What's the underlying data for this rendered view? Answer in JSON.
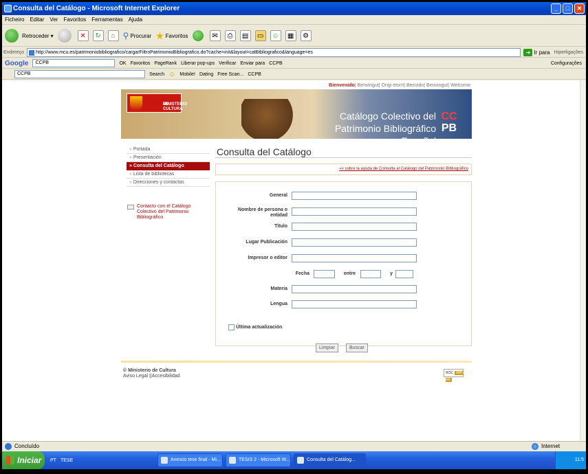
{
  "window": {
    "title": "Consulta del Catálogo - Microsoft Internet Explorer"
  },
  "menubar": [
    "Ficheiro",
    "Editar",
    "Ver",
    "Favoritos",
    "Ferramentas",
    "Ajuda"
  ],
  "toolbar": {
    "back": "Retroceder",
    "search": "Procurar",
    "favorites": "Favoritos"
  },
  "addressbar": {
    "label": "Endereço",
    "url": "http://www.mcu.es/patrimoniobibliografico/cargarFiltroPatrimonioBibliografico.do?cache=init&layout=catBibliografico&language=es",
    "go": "Ir para",
    "links": "Hiperligações"
  },
  "googlebar": {
    "logo_g": "Google",
    "query": "CCPB",
    "ok": "OK",
    "favoritos": "Favoritos",
    "pagerank": "PageRank",
    "popups": "Liberar pop-ups",
    "verificar": "Verificar",
    "enviar": "Enviar para",
    "ccpb": "CCPB",
    "config": "Configurações"
  },
  "ccpbbar": {
    "query": "CCPB",
    "search": "Search",
    "mobile": "Mobile!",
    "dating": "Dating",
    "freescan": "Free Scan...",
    "ccpb": "CCPB"
  },
  "page": {
    "welcome_prefix": "Bienvenido",
    "welcome_rest": "| Benvingut| Ongi etorri| Benvido| Benvingut| Welcome",
    "header": {
      "ministerio_line1": "MINISTERIO",
      "ministerio_line2": "DE CULTURA",
      "title_line1": "Catálogo Colectivo del",
      "title_line2": "Patrimonio Bibliográfico Español",
      "ccpb_top": "CC",
      "ccpb_bottom": "PB"
    },
    "nav": [
      "Portada",
      "Presentación",
      "Consulta del Catálogo",
      "Lista de bibliotecas",
      "Direcciones y contactos"
    ],
    "contact": "Contacto con el Catálogo Colectivo del Patrimonio Bibliográfico",
    "title": "Consulta del Catálogo",
    "help_link": "sobre la ayuda de Consulta al Catálogo del Patrimonio Bibliográfico",
    "form": {
      "general": "General",
      "persona": "Nombre de persona o entidad",
      "titulo": "Título",
      "lugar": "Lugar Publicación",
      "impresor": "Impresor o editor",
      "fecha": "Fecha",
      "entre": "entre",
      "y": "y",
      "materia": "Materia",
      "lengua": "Lengua",
      "ultima": "Última actualización",
      "limpiar": "Limpiar",
      "buscar": "Buscar"
    },
    "footer": {
      "ministerio": "© Ministerio de Cultura",
      "legal": "Aviso Legal ||Accesibilidad",
      "w3c": "W3C",
      "wai": "WAI-AA"
    }
  },
  "status": {
    "left": "Concluído",
    "right": "Internet"
  },
  "taskbar": {
    "start": "Iniciar",
    "quick1": "PT",
    "quick2": "TESE",
    "tasks": [
      "Anexos tese final - Mi...",
      "TESIS 2 - Microsoft W...",
      "Consulta del Catálog..."
    ],
    "clock": "11:5"
  }
}
